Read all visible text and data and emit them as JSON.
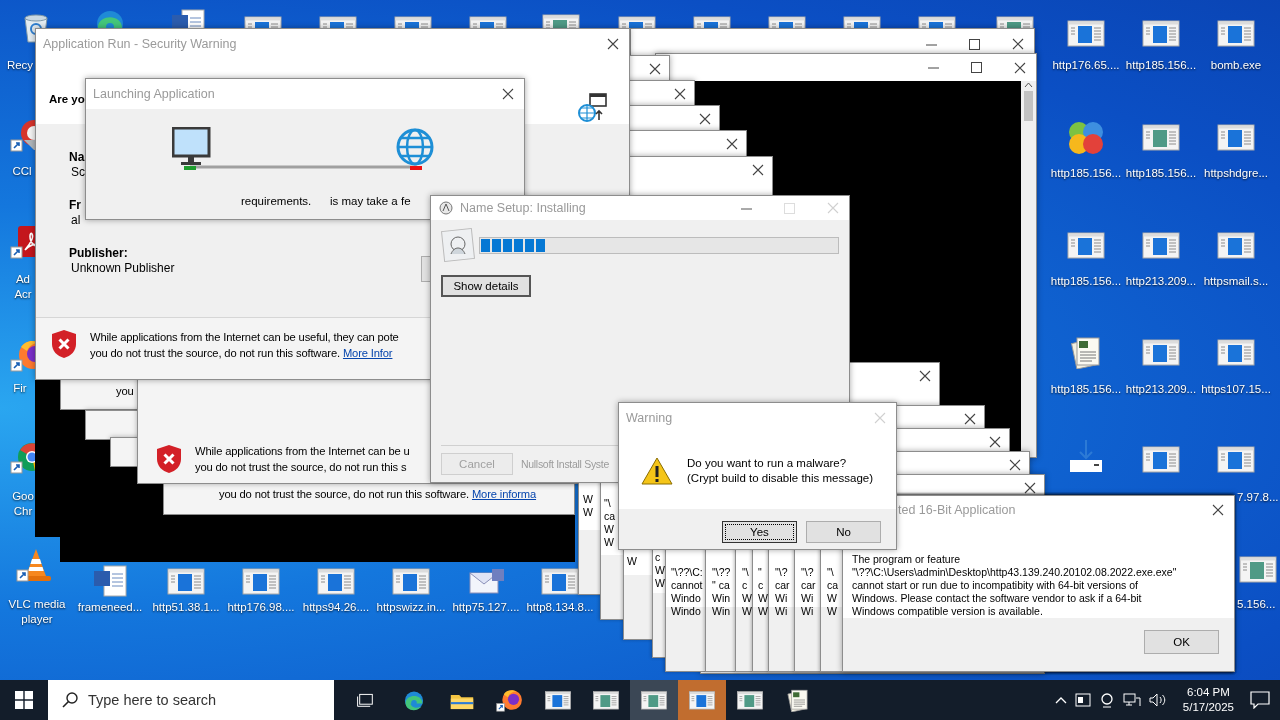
{
  "desktop_icons": [
    {
      "label": "Recy",
      "kind": "recycle"
    },
    {
      "label": "CCl",
      "kind": "cleaner"
    },
    {
      "label": "Ad Acr",
      "kind": "pdf"
    },
    {
      "label": "Fir",
      "kind": "firefox"
    },
    {
      "label": "Goo Chr",
      "kind": "chrome"
    },
    {
      "label": "VLC media player",
      "kind": "cone"
    },
    {
      "label": "frameneed...",
      "kind": "word"
    },
    {
      "label": "http51.38.1...",
      "kind": "window"
    },
    {
      "label": "http176.98....",
      "kind": "window"
    },
    {
      "label": "https94.26....",
      "kind": "window"
    },
    {
      "label": "httpswizz.in...",
      "kind": "window"
    },
    {
      "label": "http75.127....",
      "kind": "mail"
    },
    {
      "label": "http8.134.8...",
      "kind": "window"
    },
    {
      "label": "http176.65....",
      "kind": "window"
    },
    {
      "label": "http185.156...",
      "kind": "window"
    },
    {
      "label": "bomb.exe",
      "kind": "window"
    },
    {
      "label": "http185.156...",
      "kind": "balls"
    },
    {
      "label": "http185.156...",
      "kind": "screen"
    },
    {
      "label": "httpshdgre...",
      "kind": "window"
    },
    {
      "label": "http185.156...",
      "kind": "window"
    },
    {
      "label": "http213.209...",
      "kind": "window"
    },
    {
      "label": "httpsmail.s...",
      "kind": "window"
    },
    {
      "label": "http185.156...",
      "kind": "papers"
    },
    {
      "label": "http213.209...",
      "kind": "window"
    },
    {
      "label": "https107.15...",
      "kind": "window"
    },
    {
      "label": "7.97.8...",
      "kind": "window"
    },
    {
      "label": "5.156...",
      "kind": "screen"
    }
  ],
  "security_warnings_behind": [
    {
      "message": [
        "you"
      ]
    },
    {
      "message": [
        "While applications from the Internet can be u",
        "you do not trust the source, do not run this s"
      ]
    },
    {
      "message": [
        "you do not trust the source, do not run this software."
      ],
      "link": "More informa"
    }
  ],
  "security_warning": {
    "title": "Application Run - Security Warning",
    "heading": [
      "Are yo"
    ],
    "fields": [
      {
        "label": "Na",
        "value": "Sc"
      },
      {
        "label": "Fr",
        "value": "al"
      },
      {
        "label": "Publisher:",
        "value": "Unknown Publisher"
      }
    ],
    "message": [
      "While applications from the Internet can be useful, they can pote",
      "you do not trust the source, do not run this software."
    ],
    "link": "More Infor"
  },
  "launching": {
    "title": "Launching Application",
    "status": [
      "requirements.",
      "is may take a fe"
    ]
  },
  "error_windows_behind": [
    {
      "lines": [
        "W",
        "W"
      ]
    },
    {
      "lines": [
        "\"\\",
        "ca",
        "W",
        "W"
      ]
    },
    {
      "lines": [
        "W"
      ]
    },
    {
      "lines": [
        "c",
        "W",
        "W"
      ]
    }
  ],
  "installer": {
    "title": "Name Setup: Installing",
    "progress": {
      "level": 0.18
    },
    "show_details": "Show details",
    "cancel": {
      "label": "Cancel",
      "disabled": true
    },
    "brand": "Nullsoft Install Syste"
  },
  "error_windows": [
    {
      "lines": [
        "\"\\??\\C:",
        "cannot",
        "Windo",
        "Windo"
      ]
    },
    {
      "lines": [
        "\"\\??",
        "\" ca",
        "Win",
        "Win"
      ]
    },
    {
      "lines": [
        "\"\\",
        "c",
        "W",
        "W"
      ]
    },
    {
      "lines": [
        "\"",
        "c",
        "W",
        "W"
      ]
    },
    {
      "lines": [
        "\"\\?",
        "car",
        "Wi",
        "Wi"
      ]
    },
    {
      "lines": [
        "\"\\?",
        "car",
        "Wi",
        "Wi"
      ]
    },
    {
      "lines": [
        "\"\\",
        "ca",
        "W",
        "W"
      ]
    }
  ],
  "error_16bit": {
    "title": "ted 16-Bit Application",
    "message": [
      "The program or feature",
      "\"\\??\\C:\\Users\\admin\\Desktop\\http43.139.240.20102.08.2022.exe.exe\"",
      "cannot start or run due to incompatibity with 64-bit versions of",
      "Windows. Please contact the software vendor to ask if a 64-bit",
      "Windows compatible version is available."
    ],
    "ok": "OK"
  },
  "warning": {
    "title": "Warning",
    "message": [
      "Do you want to run a malware?",
      "(Crypt build to disable this message)"
    ],
    "buttons": [
      {
        "label": "Yes",
        "focused": true
      },
      {
        "label": "No",
        "focused": false
      }
    ]
  },
  "taskbar": {
    "search": {
      "placeholder": "Type here to search"
    },
    "apps": [
      {
        "kind": "taskview",
        "selected": false,
        "hovered": false
      },
      {
        "kind": "edge",
        "selected": false,
        "hovered": false
      },
      {
        "kind": "folder",
        "selected": false,
        "hovered": false
      },
      {
        "kind": "firefox",
        "selected": false,
        "hovered": false
      },
      {
        "kind": "window",
        "selected": false,
        "hovered": false
      },
      {
        "kind": "screen",
        "selected": false,
        "hovered": false
      },
      {
        "kind": "screen",
        "selected": false,
        "hovered": true
      },
      {
        "kind": "window",
        "selected": true,
        "hovered": false
      },
      {
        "kind": "screen",
        "selected": false,
        "hovered": false
      },
      {
        "kind": "papers",
        "selected": false,
        "hovered": false
      }
    ],
    "clock": {
      "time": "6:04 PM",
      "date": "5/17/2025"
    }
  }
}
